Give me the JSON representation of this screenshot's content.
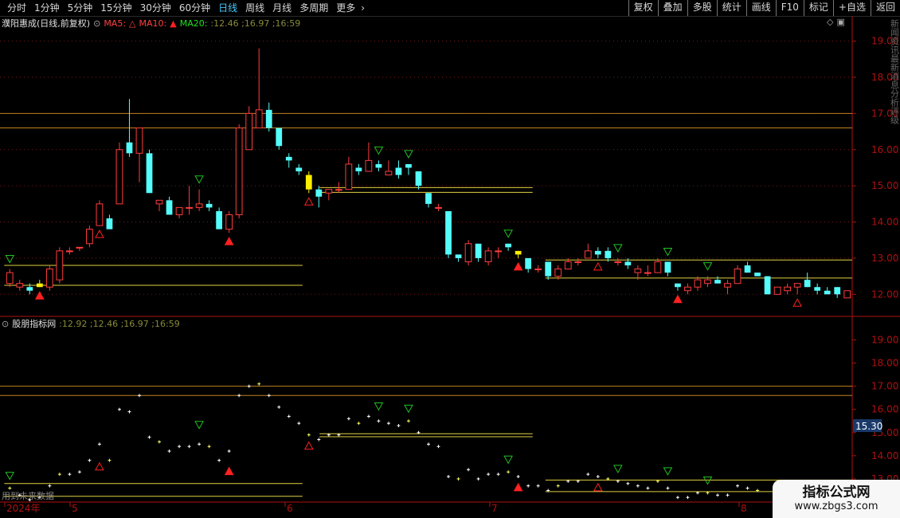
{
  "toolbar": {
    "left_items": [
      {
        "label": "分时",
        "active": false
      },
      {
        "label": "1分钟",
        "active": false
      },
      {
        "label": "5分钟",
        "active": false
      },
      {
        "label": "15分钟",
        "active": false
      },
      {
        "label": "30分钟",
        "active": false
      },
      {
        "label": "60分钟",
        "active": false
      },
      {
        "label": "日线",
        "active": true
      },
      {
        "label": "周线",
        "active": false
      },
      {
        "label": "月线",
        "active": false
      },
      {
        "label": "多周期",
        "active": false
      },
      {
        "label": "更多",
        "active": false
      }
    ],
    "right_items": [
      "复权",
      "叠加",
      "多股",
      "统计",
      "画线",
      "F10",
      "标记",
      "+自选",
      "返回"
    ]
  },
  "main_legend": {
    "title": "濮阳惠成(日线,前复权)",
    "ma5_label": "MA5:",
    "ma10_label": "MA10:",
    "ma20_label": "MA20:",
    "values": ":12.46 ;16.97 ;16:59",
    "diamond": "◇",
    "panel_toggle": "▣"
  },
  "sub_legend": {
    "title": "股朋指标网",
    "values": ":12.92 ;12.46 ;16.97 ;16:59"
  },
  "main_axis": [
    "19.00",
    "18.00",
    "17.00",
    "16.00",
    "15.00",
    "14.00",
    "13.00",
    "12.00"
  ],
  "sub_axis": [
    "19.00",
    "18.00",
    "17.00",
    "16.00",
    "15.00",
    "14.00",
    "13.00"
  ],
  "sub_price_badge": "15.30",
  "date_axis": [
    "2024年",
    "5",
    "6",
    "7",
    "8"
  ],
  "future_note": "用到未来数据",
  "side_text": "新闻资讯最新消息分析评级",
  "watermark": {
    "title": "指标公式网",
    "url": "www.zbgs3.com"
  },
  "colors": {
    "up": "#ff3c3c",
    "down": "#54fcfc",
    "axis_red": "#b01010",
    "grid": "#7a1a1a",
    "orange_line": "#c08020",
    "yellow_line": "#e0d040",
    "green_mark": "#20c020",
    "red_mark": "#ff2020",
    "cross": "#ffffff",
    "cross_yellow": "#ffff60"
  },
  "chart_data": {
    "type": "candlestick",
    "ylim": [
      11.5,
      19.3
    ],
    "sub_ylim": [
      12.0,
      19.5
    ],
    "candles": [
      {
        "o": 12.3,
        "h": 12.7,
        "l": 12.2,
        "c": 12.6
      },
      {
        "o": 12.2,
        "h": 12.4,
        "l": 12.1,
        "c": 12.3
      },
      {
        "o": 12.2,
        "h": 12.3,
        "l": 12.0,
        "c": 12.1
      },
      {
        "o": 12.3,
        "h": 12.4,
        "l": 12.2,
        "c": 12.2
      },
      {
        "o": 12.2,
        "h": 12.8,
        "l": 12.1,
        "c": 12.7
      },
      {
        "o": 12.4,
        "h": 13.3,
        "l": 12.3,
        "c": 13.2
      },
      {
        "o": 13.2,
        "h": 13.3,
        "l": 13.1,
        "c": 13.2
      },
      {
        "o": 13.3,
        "h": 13.3,
        "l": 13.2,
        "c": 13.3
      },
      {
        "o": 13.4,
        "h": 13.9,
        "l": 13.3,
        "c": 13.8
      },
      {
        "o": 13.9,
        "h": 14.6,
        "l": 13.9,
        "c": 14.5
      },
      {
        "o": 14.1,
        "h": 14.2,
        "l": 13.8,
        "c": 13.8
      },
      {
        "o": 14.5,
        "h": 16.2,
        "l": 14.5,
        "c": 16.0
      },
      {
        "o": 16.2,
        "h": 17.4,
        "l": 15.8,
        "c": 15.9
      },
      {
        "o": 15.9,
        "h": 16.6,
        "l": 15.1,
        "c": 16.6
      },
      {
        "o": 15.9,
        "h": 16.0,
        "l": 14.8,
        "c": 14.8
      },
      {
        "o": 14.5,
        "h": 14.6,
        "l": 14.3,
        "c": 14.6
      },
      {
        "o": 14.6,
        "h": 14.7,
        "l": 14.2,
        "c": 14.2
      },
      {
        "o": 14.2,
        "h": 14.4,
        "l": 14.1,
        "c": 14.4
      },
      {
        "o": 14.4,
        "h": 15.0,
        "l": 14.2,
        "c": 14.4
      },
      {
        "o": 14.4,
        "h": 14.9,
        "l": 14.3,
        "c": 14.5
      },
      {
        "o": 14.5,
        "h": 14.6,
        "l": 14.3,
        "c": 14.4
      },
      {
        "o": 14.3,
        "h": 14.4,
        "l": 13.8,
        "c": 13.8
      },
      {
        "o": 13.8,
        "h": 14.3,
        "l": 13.7,
        "c": 14.2
      },
      {
        "o": 14.2,
        "h": 16.7,
        "l": 14.1,
        "c": 16.6
      },
      {
        "o": 16.0,
        "h": 17.2,
        "l": 16.0,
        "c": 17.0
      },
      {
        "o": 16.6,
        "h": 18.8,
        "l": 16.6,
        "c": 17.1
      },
      {
        "o": 17.1,
        "h": 17.3,
        "l": 16.5,
        "c": 16.6
      },
      {
        "o": 16.6,
        "h": 16.5,
        "l": 16.0,
        "c": 16.1
      },
      {
        "o": 15.8,
        "h": 15.9,
        "l": 15.5,
        "c": 15.7
      },
      {
        "o": 15.5,
        "h": 15.6,
        "l": 15.3,
        "c": 15.4
      },
      {
        "o": 15.3,
        "h": 15.4,
        "l": 14.8,
        "c": 14.9
      },
      {
        "o": 14.9,
        "h": 15.0,
        "l": 14.4,
        "c": 14.7
      },
      {
        "o": 14.8,
        "h": 14.9,
        "l": 14.6,
        "c": 14.9
      },
      {
        "o": 14.9,
        "h": 15.1,
        "l": 14.8,
        "c": 14.9
      },
      {
        "o": 14.9,
        "h": 15.8,
        "l": 14.9,
        "c": 15.6
      },
      {
        "o": 15.5,
        "h": 15.6,
        "l": 15.3,
        "c": 15.4
      },
      {
        "o": 15.4,
        "h": 16.2,
        "l": 15.4,
        "c": 15.7
      },
      {
        "o": 15.6,
        "h": 15.7,
        "l": 15.4,
        "c": 15.5
      },
      {
        "o": 15.3,
        "h": 15.7,
        "l": 15.3,
        "c": 15.4
      },
      {
        "o": 15.5,
        "h": 15.7,
        "l": 15.2,
        "c": 15.3
      },
      {
        "o": 15.6,
        "h": 15.6,
        "l": 15.3,
        "c": 15.5
      },
      {
        "o": 15.4,
        "h": 15.4,
        "l": 14.9,
        "c": 15.0
      },
      {
        "o": 14.8,
        "h": 14.8,
        "l": 14.4,
        "c": 14.5
      },
      {
        "o": 14.4,
        "h": 14.5,
        "l": 14.3,
        "c": 14.4
      },
      {
        "o": 14.3,
        "h": 14.3,
        "l": 13.0,
        "c": 13.1
      },
      {
        "o": 13.1,
        "h": 13.1,
        "l": 12.9,
        "c": 13.0
      },
      {
        "o": 12.9,
        "h": 13.5,
        "l": 12.8,
        "c": 13.4
      },
      {
        "o": 13.4,
        "h": 13.4,
        "l": 12.9,
        "c": 13.0
      },
      {
        "o": 12.9,
        "h": 13.3,
        "l": 12.8,
        "c": 13.2
      },
      {
        "o": 13.2,
        "h": 13.3,
        "l": 13.0,
        "c": 13.2
      },
      {
        "o": 13.4,
        "h": 13.4,
        "l": 13.2,
        "c": 13.3
      },
      {
        "o": 13.2,
        "h": 13.2,
        "l": 13.0,
        "c": 13.1
      },
      {
        "o": 13.0,
        "h": 13.0,
        "l": 12.6,
        "c": 12.7
      },
      {
        "o": 12.7,
        "h": 12.8,
        "l": 12.6,
        "c": 12.7
      },
      {
        "o": 12.9,
        "h": 12.9,
        "l": 12.4,
        "c": 12.5
      },
      {
        "o": 12.5,
        "h": 12.8,
        "l": 12.4,
        "c": 12.7
      },
      {
        "o": 12.7,
        "h": 13.0,
        "l": 12.7,
        "c": 12.9
      },
      {
        "o": 12.9,
        "h": 13.0,
        "l": 12.8,
        "c": 12.9
      },
      {
        "o": 13.0,
        "h": 13.4,
        "l": 13.0,
        "c": 13.2
      },
      {
        "o": 13.2,
        "h": 13.3,
        "l": 13.0,
        "c": 13.1
      },
      {
        "o": 13.2,
        "h": 13.3,
        "l": 12.9,
        "c": 13.0
      },
      {
        "o": 12.9,
        "h": 13.0,
        "l": 12.8,
        "c": 12.9
      },
      {
        "o": 12.9,
        "h": 13.0,
        "l": 12.7,
        "c": 12.8
      },
      {
        "o": 12.6,
        "h": 12.8,
        "l": 12.4,
        "c": 12.7
      },
      {
        "o": 12.6,
        "h": 12.8,
        "l": 12.5,
        "c": 12.6
      },
      {
        "o": 12.6,
        "h": 13.0,
        "l": 12.6,
        "c": 12.9
      },
      {
        "o": 12.9,
        "h": 12.9,
        "l": 12.5,
        "c": 12.6
      },
      {
        "o": 12.3,
        "h": 12.3,
        "l": 12.1,
        "c": 12.2
      },
      {
        "o": 12.1,
        "h": 12.3,
        "l": 12.0,
        "c": 12.2
      },
      {
        "o": 12.2,
        "h": 12.5,
        "l": 12.1,
        "c": 12.4
      },
      {
        "o": 12.3,
        "h": 12.5,
        "l": 12.2,
        "c": 12.4
      },
      {
        "o": 12.4,
        "h": 12.5,
        "l": 12.3,
        "c": 12.3
      },
      {
        "o": 12.2,
        "h": 12.4,
        "l": 12.0,
        "c": 12.3
      },
      {
        "o": 12.3,
        "h": 12.8,
        "l": 12.3,
        "c": 12.7
      },
      {
        "o": 12.8,
        "h": 12.9,
        "l": 12.6,
        "c": 12.6
      },
      {
        "o": 12.6,
        "h": 12.6,
        "l": 12.5,
        "c": 12.5
      },
      {
        "o": 12.5,
        "h": 12.5,
        "l": 12.0,
        "c": 12.0
      },
      {
        "o": 12.0,
        "h": 12.2,
        "l": 12.0,
        "c": 12.2
      },
      {
        "o": 12.1,
        "h": 12.3,
        "l": 12.0,
        "c": 12.2
      },
      {
        "o": 12.2,
        "h": 12.3,
        "l": 12.0,
        "c": 12.3
      },
      {
        "o": 12.4,
        "h": 12.6,
        "l": 12.2,
        "c": 12.2
      },
      {
        "o": 12.2,
        "h": 12.3,
        "l": 12.0,
        "c": 12.1
      },
      {
        "o": 12.1,
        "h": 12.2,
        "l": 12.0,
        "c": 12.0
      },
      {
        "o": 12.2,
        "h": 12.2,
        "l": 11.9,
        "c": 12.0
      },
      {
        "o": 11.9,
        "h": 12.1,
        "l": 11.9,
        "c": 12.1
      }
    ],
    "yellow_candles": [
      3,
      30,
      51
    ],
    "hlines_main": [
      {
        "y": 17.0,
        "x0": 0,
        "x1": 1,
        "color": "orange"
      },
      {
        "y": 16.6,
        "x0": 0,
        "x1": 1,
        "color": "orange"
      },
      {
        "y": 12.8,
        "x0": 0.005,
        "x1": 0.355,
        "color": "yellow"
      },
      {
        "y": 12.25,
        "x0": 0.005,
        "x1": 0.355,
        "color": "yellow"
      },
      {
        "y": 14.95,
        "x0": 0.375,
        "x1": 0.625,
        "color": "yellow"
      },
      {
        "y": 14.82,
        "x0": 0.375,
        "x1": 0.625,
        "color": "yellow"
      },
      {
        "y": 12.95,
        "x0": 0.64,
        "x1": 1,
        "color": "yellow"
      },
      {
        "y": 12.45,
        "x0": 0.64,
        "x1": 1,
        "color": "yellow"
      }
    ],
    "green_marks": [
      0,
      19,
      37,
      40,
      50,
      61,
      66,
      70
    ],
    "red_marks": [
      3,
      9,
      22,
      30,
      51,
      59,
      67,
      79
    ]
  }
}
